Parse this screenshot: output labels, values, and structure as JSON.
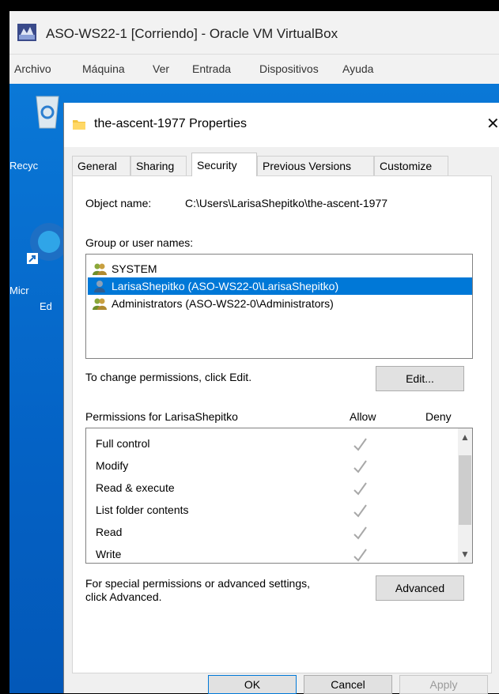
{
  "vm_window": {
    "title": "ASO-WS22-1 [Corriendo] - Oracle VM VirtualBox",
    "menu": [
      "Archivo",
      "Máquina",
      "Ver",
      "Entrada",
      "Dispositivos",
      "Ayuda"
    ]
  },
  "desktop": {
    "icons": [
      {
        "label": "Recyc",
        "icon": "recycle-bin-icon"
      },
      {
        "label": "Micr",
        "label2": "Ed",
        "icon": "edge-icon"
      }
    ]
  },
  "dialog": {
    "title": "the-ascent-1977 Properties",
    "tabs": [
      "General",
      "Sharing",
      "Security",
      "Previous Versions",
      "Customize"
    ],
    "active_tab": "Security",
    "object_name_label": "Object name:",
    "object_name_value": "C:\\Users\\LarisaShepitko\\the-ascent-1977",
    "group_label": "Group or user names:",
    "users": [
      "SYSTEM",
      "LarisaShepitko (ASO-WS22-0\\LarisaShepitko)",
      "Administrators (ASO-WS22-0\\Administrators)"
    ],
    "selected_user_index": 1,
    "change_perm_text": "To change permissions, click Edit.",
    "edit_button": "Edit...",
    "permissions_for": "Permissions for LarisaShepitko",
    "allow_header": "Allow",
    "deny_header": "Deny",
    "permissions": [
      {
        "name": "Full control",
        "allow": true,
        "deny": false
      },
      {
        "name": "Modify",
        "allow": true,
        "deny": false
      },
      {
        "name": "Read & execute",
        "allow": true,
        "deny": false
      },
      {
        "name": "List folder contents",
        "allow": true,
        "deny": false
      },
      {
        "name": "Read",
        "allow": true,
        "deny": false
      },
      {
        "name": "Write",
        "allow": true,
        "deny": false
      }
    ],
    "special_text_1": "For special permissions or advanced settings,",
    "special_text_2": "click Advanced.",
    "advanced_button": "Advanced",
    "ok_button": "OK",
    "cancel_button": "Cancel",
    "apply_button": "Apply"
  },
  "colors": {
    "selection": "#0078d7",
    "desktop": "#0a78d7",
    "checkmark": "#a8a8a8"
  }
}
